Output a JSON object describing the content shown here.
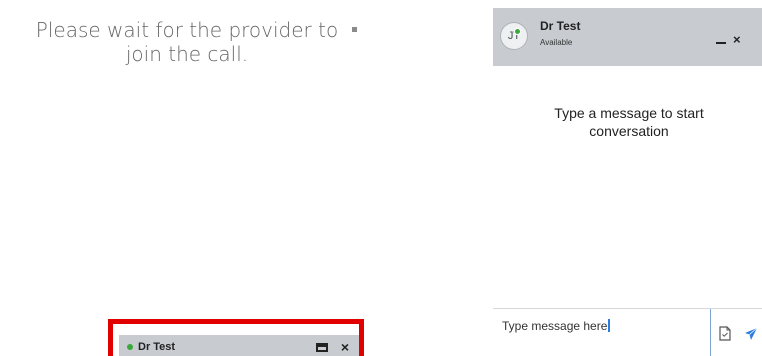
{
  "waiting": {
    "message": "Please wait for the provider to join the call."
  },
  "minimized_chat": {
    "name": "Dr Test",
    "maximize_icon": "window-icon",
    "close_icon": "close-icon",
    "status_color": "#3aa83a",
    "highlight_color": "#e00000"
  },
  "chat": {
    "avatar_initials": "JT",
    "name": "Dr Test",
    "status": "Available",
    "status_color": "#3aa83a",
    "minimize_label": "–",
    "close_label": "×",
    "empty_message": "Type a message to start conversation",
    "input_value": "Type message here",
    "attach_icon": "document-icon",
    "send_icon": "send-icon"
  }
}
